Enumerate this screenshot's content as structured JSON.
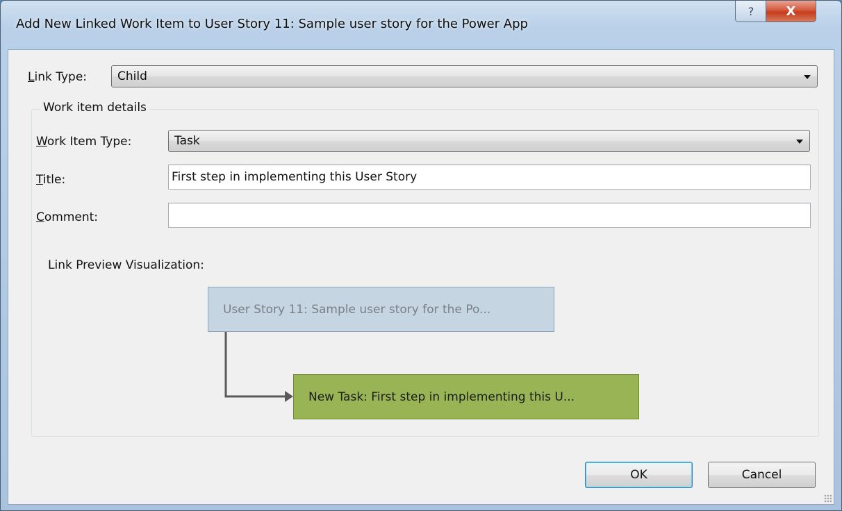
{
  "window": {
    "title": "Add New Linked Work Item to User Story 11: Sample user story for the Power App",
    "help_symbol": "?",
    "close_symbol": "X"
  },
  "link_type": {
    "label_key": "L",
    "label_rest": "ink Type:",
    "value": "Child"
  },
  "work_item_details": {
    "legend": "Work item details",
    "type": {
      "label_key": "W",
      "label_rest": "ork Item Type:",
      "value": "Task"
    },
    "title": {
      "label_key": "T",
      "label_rest": "itle:",
      "value": "First step in implementing this User Story"
    },
    "comment": {
      "label_key": "C",
      "label_rest": "omment:",
      "value": ""
    },
    "preview": {
      "label": "Link Preview Visualization:",
      "parent": "User Story 11: Sample user story for the Po...",
      "child": "New Task: First step in implementing this U..."
    }
  },
  "buttons": {
    "ok": "OK",
    "cancel": "Cancel"
  },
  "colors": {
    "parent_node": "#c5d5e1",
    "child_node": "#99b454",
    "connector": "#595959"
  }
}
